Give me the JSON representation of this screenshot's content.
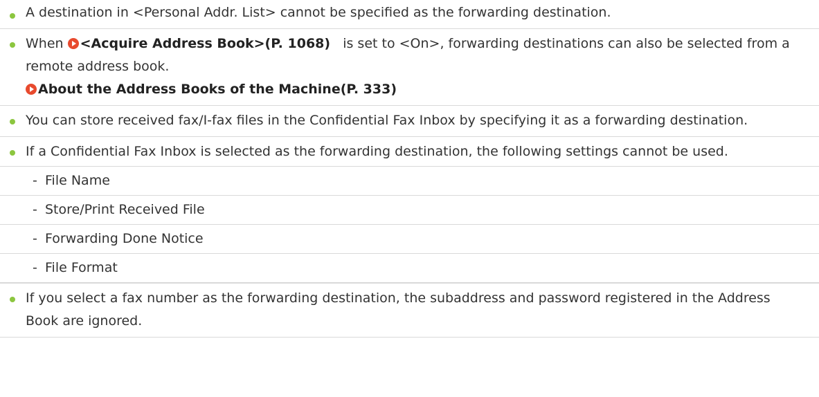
{
  "colors": {
    "bullet": "#8cc63f",
    "link_icon": "#e84a2e",
    "text": "#333333",
    "divider": "#d9d9d9"
  },
  "items": {
    "0": {
      "text": "A destination in <Personal Addr. List> cannot be specified as the forwarding destination."
    },
    "1": {
      "prefix": "When ",
      "link": "<Acquire Address Book>(P. 1068)",
      "suffix": "   is set to <On>, forwarding destinations can also be selected from a remote address book.",
      "second_link": "About the Address Books of the Machine(P. 333)"
    },
    "2": {
      "text": "You can store received fax/I-fax files in the Confidential Fax Inbox by specifying it as a forwarding destination."
    },
    "3": {
      "text": "If a Confidential Fax Inbox is selected as the forwarding destination, the following settings cannot be used.",
      "subitems": [
        "File Name",
        "Store/Print Received File",
        "Forwarding Done Notice",
        "File Format"
      ],
      "dash": "-"
    },
    "4": {
      "text": "If you select a fax number as the forwarding destination, the subaddress and password registered in the Address Book are ignored."
    }
  }
}
